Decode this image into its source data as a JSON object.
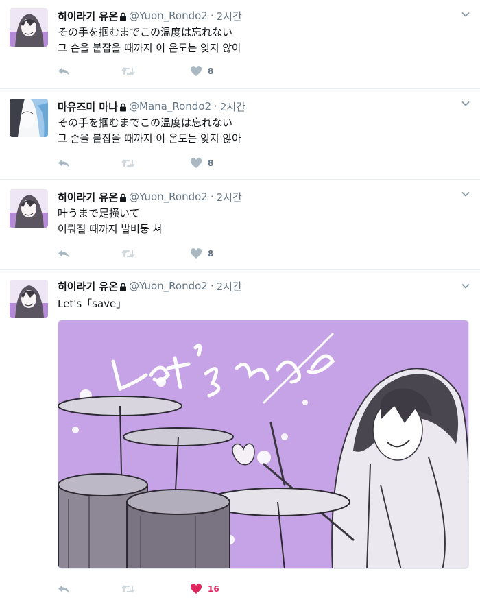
{
  "tweets": [
    {
      "name": "히이라기 유온",
      "handle": "@Yuon_Rondo2",
      "time": "2시간",
      "lines": "その手を掴むまでこの温度は忘れない\n그 손을 붙잡을 때까지 이 온도는 잊지 않아",
      "likes": "8"
    },
    {
      "name": "마유즈미 마나",
      "handle": "@Mana_Rondo2",
      "time": "2시간",
      "lines": "その手を掴むまでこの温度は忘れない\n그 손을 붙잡을 때까지 이 온도는 잊지 않아",
      "likes": "8"
    },
    {
      "name": "히이라기 유온",
      "handle": "@Yuon_Rondo2",
      "time": "2시간",
      "lines": "叶うまで足掻いて\n이뤄질 때까지 발버둥 쳐",
      "likes": "8"
    },
    {
      "name": "히이라기 유온",
      "handle": "@Yuon_Rondo2",
      "time": "2시간",
      "lines": "Let's「save」",
      "likes": "16",
      "liked": true,
      "media_lettering": "Let's save"
    }
  ],
  "colors": {
    "muted": "#657786",
    "like_active": "#e0245e",
    "media_bg": "#c6a2e6"
  },
  "icons": [
    "lock-icon",
    "reply-icon",
    "retweet-icon",
    "heart-icon",
    "chevron-down-icon"
  ]
}
